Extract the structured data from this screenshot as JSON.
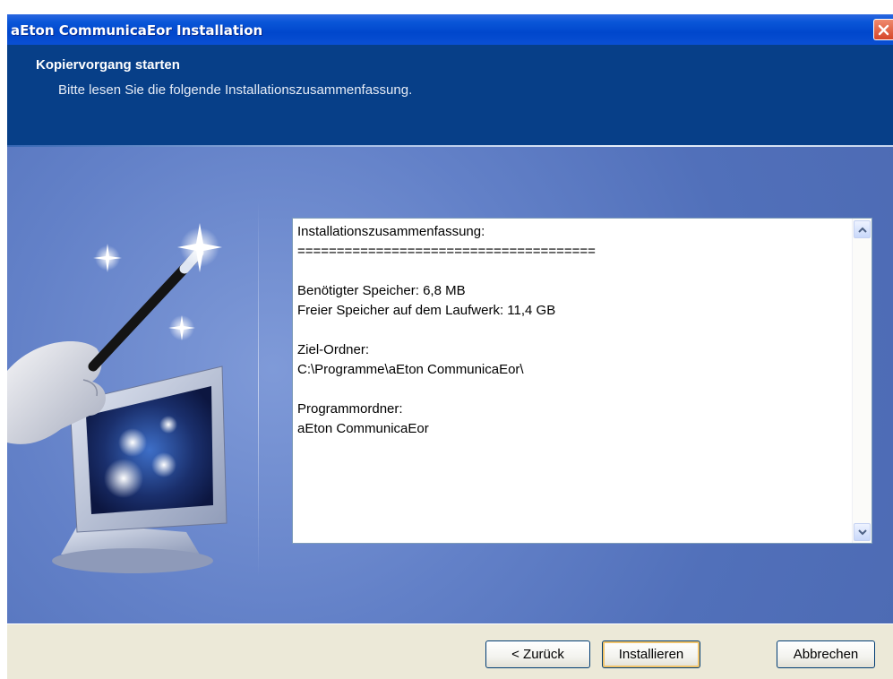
{
  "window": {
    "title": "aEton CommunicaEor Installation",
    "close_icon": "close-icon"
  },
  "header": {
    "title": "Kopiervorgang starten",
    "subtitle": "Bitte lesen Sie die folgende Installationszusammenfassung."
  },
  "illustration": {
    "icon": "magic-wand-monitor-icon"
  },
  "summary": {
    "text": "Installationszusammenfassung:\n======================================\n\nBenötigter Speicher: 6,8 MB\nFreier Speicher auf dem Laufwerk: 11,4 GB\n\nZiel-Ordner:\nC:\\Programme\\aEton CommunicaEor\\\n\nProgrammordner:\naEton CommunicaEor",
    "scroll_up_icon": "scroll-up-arrow-icon",
    "scroll_down_icon": "scroll-down-arrow-icon"
  },
  "buttons": {
    "back": "< Zurück",
    "install": "Installieren",
    "cancel": "Abbrechen"
  },
  "colors": {
    "titlebar": "#0047cc",
    "header_bg": "#073f88",
    "body_bg": "#6381c8",
    "footer_bg": "#ece9d8",
    "close_button": "#d6462a"
  }
}
